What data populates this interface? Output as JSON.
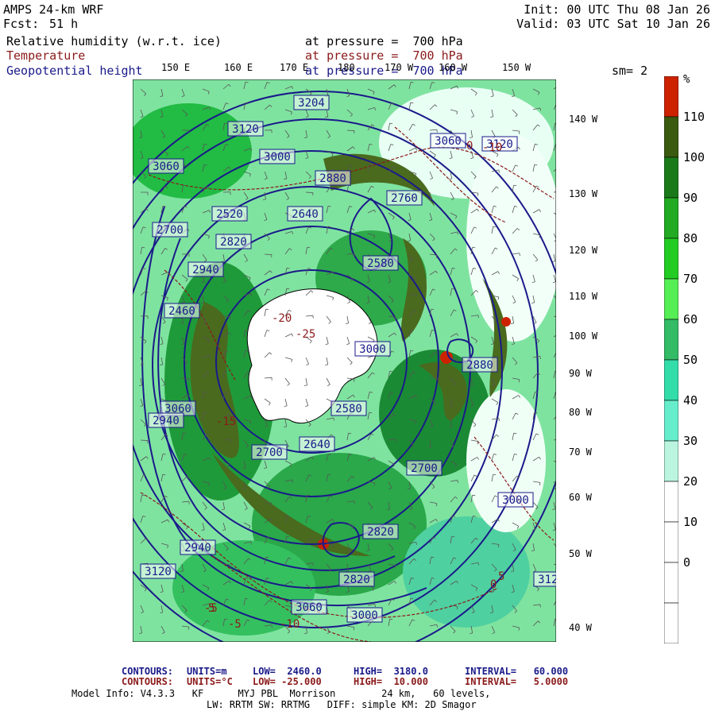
{
  "header": {
    "model": "AMPS 24-km WRF",
    "fcst_label": "Fcst:",
    "fcst_value": "51 h",
    "init": "Init: 00 UTC Thu 08 Jan 26",
    "valid": "Valid: 03 UTC Sat 10 Jan 26"
  },
  "fields": [
    {
      "name": "Relative humidity (w.r.t. ice)",
      "level": "at pressure =  700 hPa",
      "color": "#000000"
    },
    {
      "name": "Temperature",
      "level": "at pressure =  700 hPa",
      "color": "#8b1a1a"
    },
    {
      "name": "Geopotential height",
      "level": "at pressure =  700 hPa",
      "color": "#1a1a8a"
    }
  ],
  "smoothing": "sm= 2",
  "top_longitudes": [
    "150 E",
    "160 E",
    "170 E",
    "180",
    "170 W",
    "160 W",
    "150 W"
  ],
  "right_longitudes": [
    "140 W",
    "130 W",
    "120 W",
    "110 W",
    "100 W",
    "90 W",
    "80 W",
    "70 W",
    "60 W",
    "50 W",
    "40 W"
  ],
  "height_labels": [
    "3204",
    "3120",
    "3060",
    "3000",
    "3060",
    "3120",
    "2880",
    "2760",
    "2640",
    "2580",
    "2700",
    "2820",
    "2940",
    "2460",
    "3000",
    "2580",
    "2640",
    "2700",
    "2880",
    "2520",
    "3060",
    "2940",
    "3120",
    "2820",
    "2700",
    "2820",
    "3000",
    "2940",
    "3060",
    "3000",
    "3120"
  ],
  "temperature_labels": [
    "-20",
    "-25",
    "-15",
    "-10",
    "-5",
    "0",
    "5",
    "-5",
    "-10",
    "5",
    "0"
  ],
  "colorbar": {
    "unit": "%",
    "labels": [
      "110",
      "100",
      "90",
      "80",
      "70",
      "60",
      "50",
      "40",
      "30",
      "20",
      "10",
      "0"
    ],
    "colors": [
      "#cc2200",
      "#3a5a10",
      "#1a7a1a",
      "#22aa22",
      "#22cc22",
      "#55ee55",
      "#33bb66",
      "#33ddaa",
      "#66eecc",
      "#bbf5e0",
      "#ffffff",
      "#ffffff",
      "#ffffff",
      "#ffffff"
    ]
  },
  "footer": {
    "contours_height": {
      "label": "CONTOURS:",
      "units": "UNITS=m",
      "low": "LOW=  2460.0",
      "high": "HIGH=  3180.0",
      "interval": "INTERVAL=   60.000"
    },
    "contours_temp": {
      "label": "CONTOURS:",
      "units": "UNITS=°C",
      "low": "LOW= -25.000",
      "high": "HIGH=  10.000",
      "interval": "INTERVAL=   5.0000"
    },
    "model_info": "Model Info: V4.3.3   KF      MYJ PBL  Morrison        24 km,   60 levels,",
    "model_info2": "LW: RRTM SW: RRTMG   DIFF: simple KM: 2D Smagor"
  }
}
